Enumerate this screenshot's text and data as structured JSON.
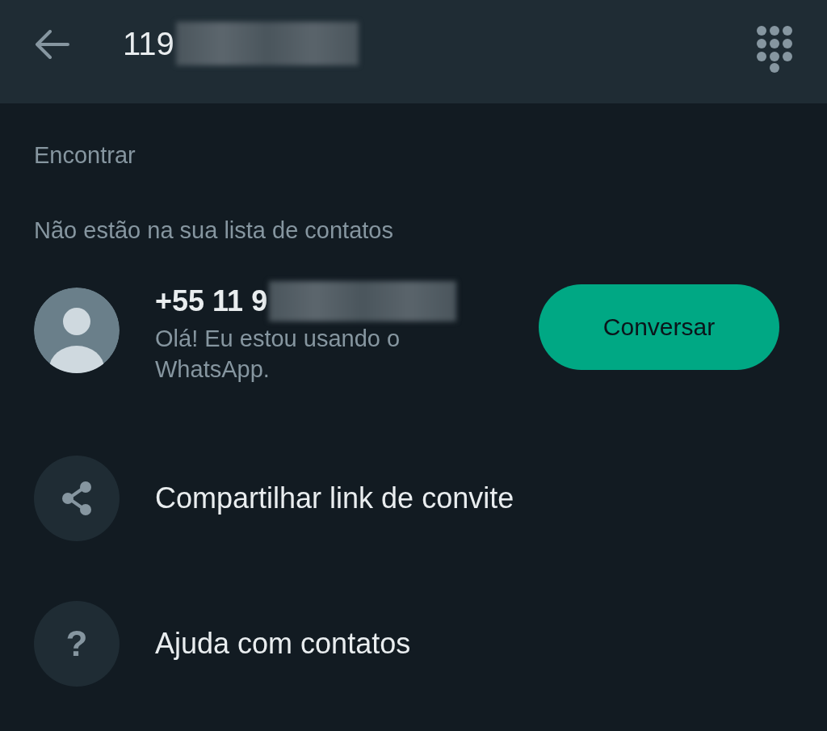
{
  "header": {
    "search_value": "119",
    "redacted": true
  },
  "section_title": "Encontrar",
  "group_title": "Não estão na sua lista de contatos",
  "contact": {
    "number": "+55 11 9",
    "redacted": true,
    "status": "Olá! Eu estou usando o WhatsApp.",
    "button": "Conversar"
  },
  "actions": [
    {
      "kind": "share",
      "label": "Compartilhar link de convite"
    },
    {
      "kind": "help",
      "glyph": "?",
      "label": "Ajuda com contatos"
    }
  ]
}
